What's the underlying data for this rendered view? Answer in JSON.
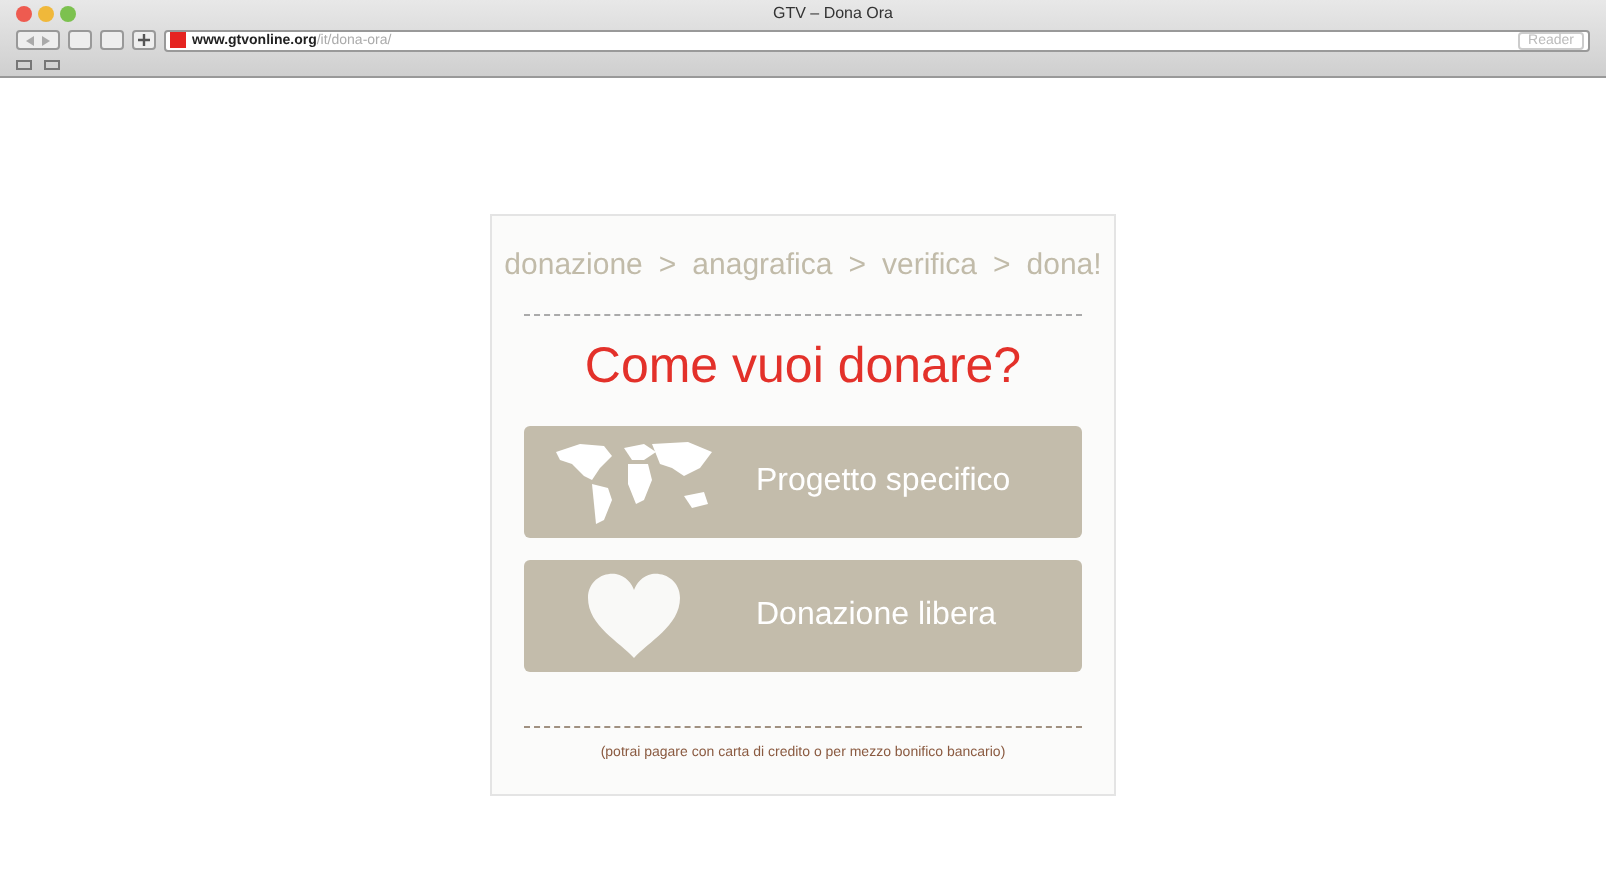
{
  "window": {
    "title": "GTV – Dona Ora"
  },
  "toolbar": {
    "url_host": "www.gtvonline.org",
    "url_path": "/it/dona-ora/",
    "reader": "Reader"
  },
  "breadcrumb": [
    {
      "label": "donazione"
    },
    {
      "label": ">"
    },
    {
      "label": "anagrafica"
    },
    {
      "label": ">"
    },
    {
      "label": "verifica"
    },
    {
      "label": ">"
    },
    {
      "label": "dona!"
    }
  ],
  "heading": "Come vuoi donare?",
  "options": [
    {
      "kind": "map",
      "label": "Progetto specifico"
    },
    {
      "kind": "heart",
      "label": "Donazione libera"
    }
  ],
  "note": "(potrai pagare con carta di credito o per mezzo bonifico bancario)"
}
